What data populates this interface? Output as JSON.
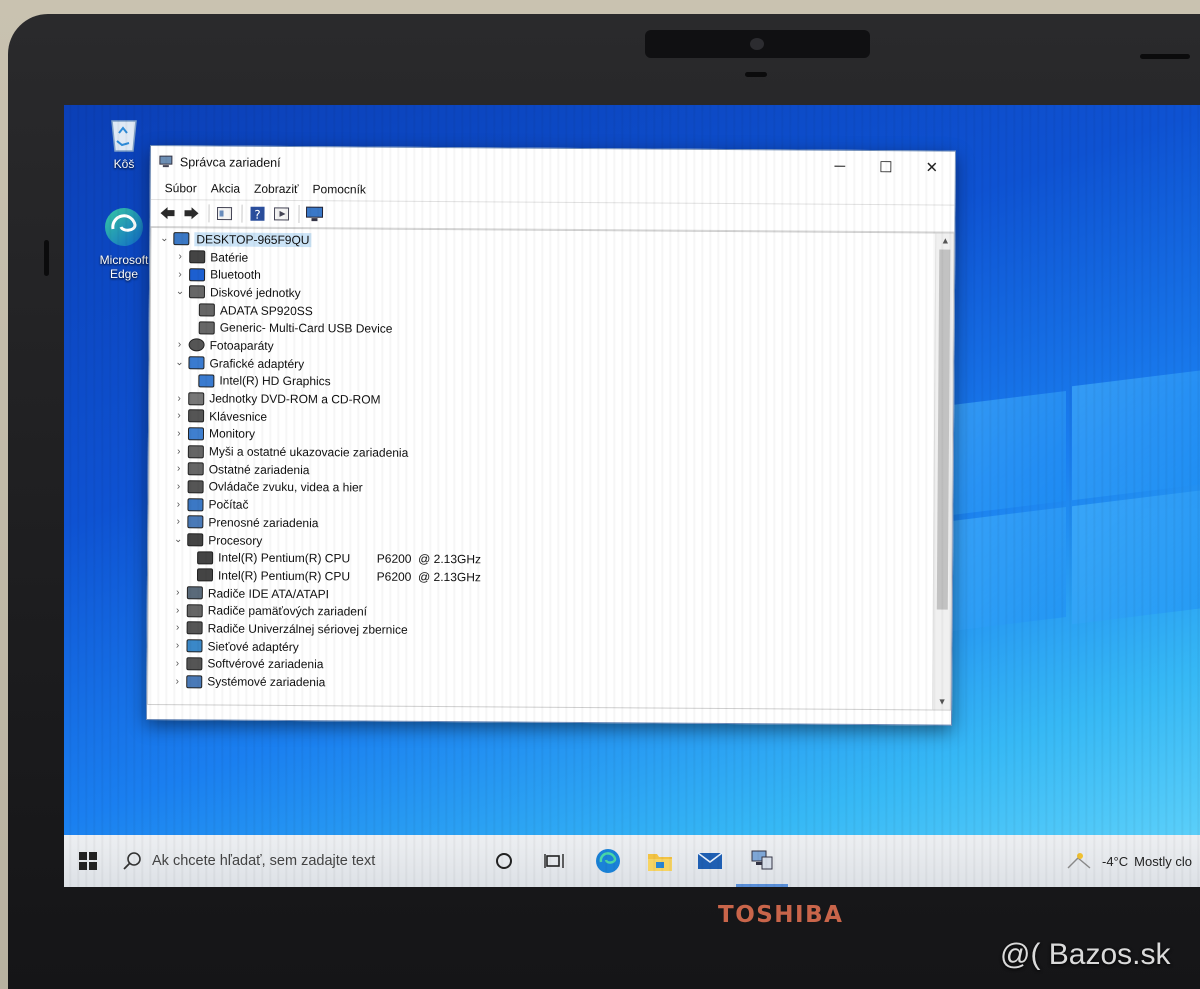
{
  "desktop": {
    "icons": [
      {
        "label": "Kôš",
        "icon": "recycle-bin-icon"
      },
      {
        "label": "Microsoft Edge",
        "icon": "edge-icon"
      }
    ]
  },
  "window": {
    "title": "Správca zariadení",
    "controls": {
      "minimize": "─",
      "maximize": "☐",
      "close": "✕"
    },
    "menu": [
      "Súbor",
      "Akcia",
      "Zobraziť",
      "Pomocník"
    ],
    "toolbar": [
      "back-arrow-icon",
      "forward-arrow-icon",
      "properties-icon",
      "help-icon",
      "view-icon",
      "monitor-icon"
    ],
    "tree": [
      {
        "label": "DESKTOP-965F9QU",
        "level": 0,
        "expanded": true,
        "icon": "computer-icon",
        "selected": true
      },
      {
        "label": "Batérie",
        "level": 1,
        "expanded": false,
        "icon": "battery-icon"
      },
      {
        "label": "Bluetooth",
        "level": 1,
        "expanded": false,
        "icon": "bluetooth-icon"
      },
      {
        "label": "Diskové jednotky",
        "level": 1,
        "expanded": true,
        "icon": "disk-icon"
      },
      {
        "label": "ADATA SP920SS",
        "level": 2,
        "icon": "disk-icon"
      },
      {
        "label": "Generic- Multi-Card USB Device",
        "level": 2,
        "icon": "disk-icon"
      },
      {
        "label": "Fotoaparáty",
        "level": 1,
        "expanded": false,
        "icon": "camera-icon"
      },
      {
        "label": "Grafické adaptéry",
        "level": 1,
        "expanded": true,
        "icon": "display-adapter-icon"
      },
      {
        "label": "Intel(R) HD Graphics",
        "level": 2,
        "icon": "display-adapter-icon"
      },
      {
        "label": "Jednotky DVD-ROM a CD-ROM",
        "level": 1,
        "expanded": false,
        "icon": "dvd-icon"
      },
      {
        "label": "Klávesnice",
        "level": 1,
        "expanded": false,
        "icon": "keyboard-icon"
      },
      {
        "label": "Monitory",
        "level": 1,
        "expanded": false,
        "icon": "monitor-icon"
      },
      {
        "label": "Myši a ostatné ukazovacie zariadenia",
        "level": 1,
        "expanded": false,
        "icon": "mouse-icon"
      },
      {
        "label": "Ostatné zariadenia",
        "level": 1,
        "expanded": false,
        "icon": "unknown-device-icon"
      },
      {
        "label": "Ovládače zvuku, videa a hier",
        "level": 1,
        "expanded": false,
        "icon": "speaker-icon"
      },
      {
        "label": "Počítač",
        "level": 1,
        "expanded": false,
        "icon": "computer-icon"
      },
      {
        "label": "Prenosné zariadenia",
        "level": 1,
        "expanded": false,
        "icon": "portable-device-icon"
      },
      {
        "label": "Procesory",
        "level": 1,
        "expanded": true,
        "icon": "processor-icon"
      },
      {
        "label": "Intel(R) Pentium(R) CPU        P6200  @ 2.13GHz",
        "level": 2,
        "icon": "processor-icon"
      },
      {
        "label": "Intel(R) Pentium(R) CPU        P6200  @ 2.13GHz",
        "level": 2,
        "icon": "processor-icon"
      },
      {
        "label": "Radiče IDE ATA/ATAPI",
        "level": 1,
        "expanded": false,
        "icon": "controller-icon"
      },
      {
        "label": "Radiče pamäťových zariadení",
        "level": 1,
        "expanded": false,
        "icon": "storage-controller-icon"
      },
      {
        "label": "Radiče Univerzálnej sériovej zbernice",
        "level": 1,
        "expanded": false,
        "icon": "usb-icon"
      },
      {
        "label": "Sieťové adaptéry",
        "level": 1,
        "expanded": false,
        "icon": "network-icon"
      },
      {
        "label": "Softvérové zariadenia",
        "level": 1,
        "expanded": false,
        "icon": "software-device-icon"
      },
      {
        "label": "Systémové zariadenia",
        "level": 1,
        "expanded": false,
        "icon": "system-device-icon"
      }
    ]
  },
  "taskbar": {
    "search_placeholder": "Ak chcete hľadať, sem zadajte text",
    "apps": [
      "cortana-icon",
      "task-view-icon",
      "edge-icon",
      "file-explorer-icon",
      "mail-icon",
      "device-manager-icon"
    ],
    "weather": {
      "temp": "-4°C",
      "desc": "Mostly clo"
    }
  },
  "photo": {
    "brand": "TOSHIBA",
    "watermark": "@( Bazos.sk"
  }
}
